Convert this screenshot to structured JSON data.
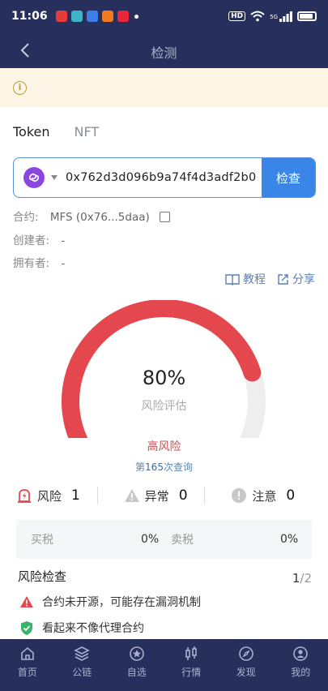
{
  "status_bar": {
    "time": "11:06",
    "hd_label": "HD",
    "network_label": "5G"
  },
  "header": {
    "title": "检测"
  },
  "tabs": [
    {
      "label": "Token",
      "active": true
    },
    {
      "label": "NFT",
      "active": false
    }
  ],
  "search": {
    "chain_icon": "polygon-icon",
    "address": "0x762d3d096b9a74f4d3adf2b0",
    "button_label": "检查"
  },
  "contract": {
    "contract_label": "合约:",
    "contract_value": "MFS (0x76...5daa)",
    "creator_label": "创建者:",
    "creator_value": "-",
    "owner_label": "拥有者:",
    "owner_value": "-"
  },
  "links": {
    "tutorial": "教程",
    "share": "分享"
  },
  "score": {
    "percent_label": "80%",
    "percent": 80,
    "caption": "风险评估",
    "level": "高风险",
    "query_prefix": "第",
    "query_count": "165",
    "query_suffix": "次查询"
  },
  "stats": [
    {
      "label": "风险",
      "value": "1"
    },
    {
      "label": "异常",
      "value": "0"
    },
    {
      "label": "注意",
      "value": "0"
    }
  ],
  "tax": {
    "buy_label": "买税",
    "buy_value": "0%",
    "sell_label": "卖税",
    "sell_value": "0%"
  },
  "checks": {
    "title": "风险检查",
    "page_current": "1",
    "page_total": "/2",
    "items": [
      {
        "text": "合约未开源，可能存在漏洞机制",
        "status": "risk"
      },
      {
        "text": "看起来不像代理合约",
        "status": "safe"
      }
    ]
  },
  "tabbar": [
    {
      "label": "首页",
      "icon": "home-icon"
    },
    {
      "label": "公链",
      "icon": "layers-icon"
    },
    {
      "label": "自选",
      "icon": "star-icon"
    },
    {
      "label": "行情",
      "icon": "candlestick-icon"
    },
    {
      "label": "发现",
      "icon": "compass-icon"
    },
    {
      "label": "我的",
      "icon": "user-icon"
    }
  ],
  "colors": {
    "nav_bg": "#27305c",
    "accent": "#3a86e8",
    "gauge_risk": "#e5474f",
    "gauge_track": "#eeeeee",
    "notice_bg": "#fdf6e6"
  }
}
